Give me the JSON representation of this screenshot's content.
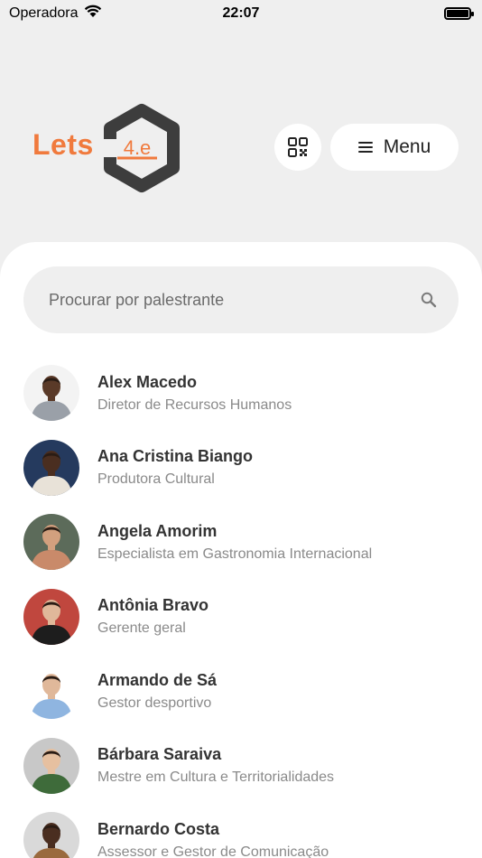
{
  "status_bar": {
    "carrier": "Operadora",
    "time": "22:07",
    "wifi_icon": "wifi-icon",
    "battery_icon": "battery-icon"
  },
  "header": {
    "logo_text": "Lets",
    "logo_badge": "4.e",
    "qr_icon": "qr-code-icon",
    "menu_icon": "hamburger-icon",
    "menu_label": "Menu"
  },
  "search": {
    "placeholder": "Procurar por palestrante",
    "icon": "search-icon"
  },
  "colors": {
    "accent": "#f07a3d",
    "logo_dark": "#3d3d3d",
    "background": "#efefef"
  },
  "speakers": [
    {
      "name": "Alex Macedo",
      "role": "Diretor de Recursos Humanos",
      "bg": "#f3f3f3",
      "shirt": "#9aa0a8",
      "skin": "#5a3a28"
    },
    {
      "name": "Ana Cristina Biango",
      "role": "Produtora Cultural",
      "bg": "#253a5e",
      "shirt": "#e8e2d8",
      "skin": "#4a2e20"
    },
    {
      "name": "Angela Amorim",
      "role": "Especialista em Gastronomia Internacional",
      "bg": "#5c6b5a",
      "shirt": "#c98a6a",
      "skin": "#d2a07e"
    },
    {
      "name": "Antônia Bravo",
      "role": "Gerente geral",
      "bg": "#c0473e",
      "shirt": "#1d1d1d",
      "skin": "#e0b89a"
    },
    {
      "name": "Armando de Sá",
      "role": "Gestor desportivo",
      "bg": "#ffffff",
      "shirt": "#8fb5e0",
      "skin": "#e0b89a"
    },
    {
      "name": "Bárbara Saraiva",
      "role": "Mestre em Cultura e Territorialidades",
      "bg": "#c8c8c8",
      "shirt": "#3e6b3a",
      "skin": "#e6c0a0"
    },
    {
      "name": "Bernardo Costa",
      "role": "Assessor e Gestor de Comunicação",
      "bg": "#d9d9d9",
      "shirt": "#9a6a3e",
      "skin": "#4a2e20"
    }
  ]
}
